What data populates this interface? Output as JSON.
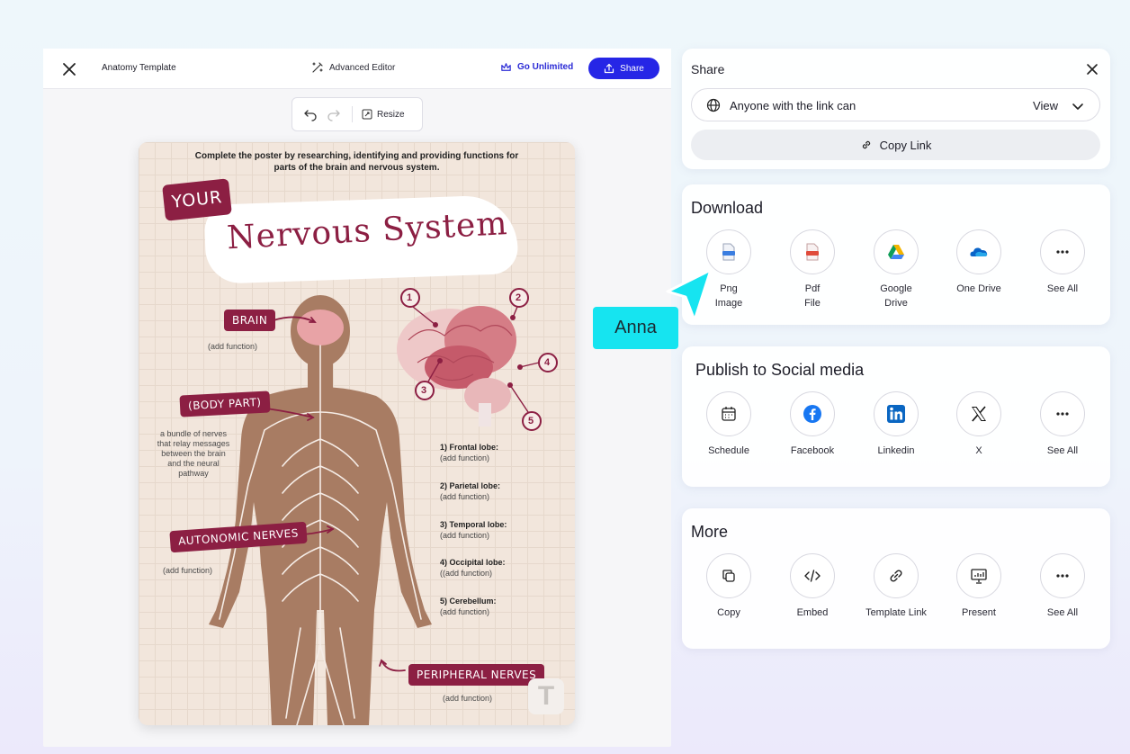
{
  "editor": {
    "template_title": "Anatomy Template",
    "advanced_editor": "Advanced Editor",
    "go_unlimited": "Go Unlimited",
    "share": "Share",
    "resize": "Resize"
  },
  "poster": {
    "intro": "Complete the poster by researching, identifying and providing functions for parts of the brain and nervous system.",
    "your": "YOUR",
    "title": "Nervous System",
    "brain_label": "BRAIN",
    "brain_note": "(add function)",
    "body_part_label": "(BODY PART)",
    "body_part_note": "a bundle of nerves that relay messages between the brain and the neural pathway",
    "autonomic_label": "AUTONOMIC NERVES",
    "autonomic_note": "(add function)",
    "peripheral_label": "PERIPHERAL NERVES",
    "peripheral_note": "(add function)",
    "markers": [
      "1",
      "2",
      "3",
      "4",
      "5"
    ],
    "lobes": [
      {
        "title": "1) Frontal lobe:",
        "fn": "(add function)"
      },
      {
        "title": "2) Parietal lobe:",
        "fn": "(add function)"
      },
      {
        "title": "3) Temporal lobe:",
        "fn": "(add function)"
      },
      {
        "title": "4) Occipital lobe:",
        "fn": "((add function)"
      },
      {
        "title": "5) Cerebellum:",
        "fn": "(add function)"
      }
    ],
    "watermark": "T"
  },
  "share_panel": {
    "title": "Share",
    "link_scope": "Anyone with the link can",
    "permission": "View",
    "copy_link": "Copy Link"
  },
  "download": {
    "title": "Download",
    "options": [
      {
        "label": "Png\nImage",
        "icon": "png-file-icon"
      },
      {
        "label": "Pdf\nFile",
        "icon": "pdf-file-icon"
      },
      {
        "label": "Google\nDrive",
        "icon": "google-drive-icon"
      },
      {
        "label": "One Drive",
        "icon": "onedrive-icon"
      },
      {
        "label": "See All",
        "icon": "more-icon"
      }
    ]
  },
  "social": {
    "title": "Publish to Social media",
    "options": [
      {
        "label": "Schedule",
        "icon": "calendar-icon"
      },
      {
        "label": "Facebook",
        "icon": "facebook-icon"
      },
      {
        "label": "Linkedin",
        "icon": "linkedin-icon"
      },
      {
        "label": "X",
        "icon": "x-icon"
      },
      {
        "label": "See All",
        "icon": "more-icon"
      }
    ]
  },
  "more": {
    "title": "More",
    "options": [
      {
        "label": "Copy",
        "icon": "copy-icon"
      },
      {
        "label": "Embed",
        "icon": "code-icon"
      },
      {
        "label": "Template Link",
        "icon": "link-icon"
      },
      {
        "label": "Present",
        "icon": "presentation-icon"
      },
      {
        "label": "See All",
        "icon": "more-icon"
      }
    ]
  },
  "collaborator": {
    "name": "Anna"
  },
  "colors": {
    "accent": "#2626e6",
    "poster_red": "#8c1f43",
    "body": "#a87c63",
    "cursor": "#16e4f0"
  }
}
